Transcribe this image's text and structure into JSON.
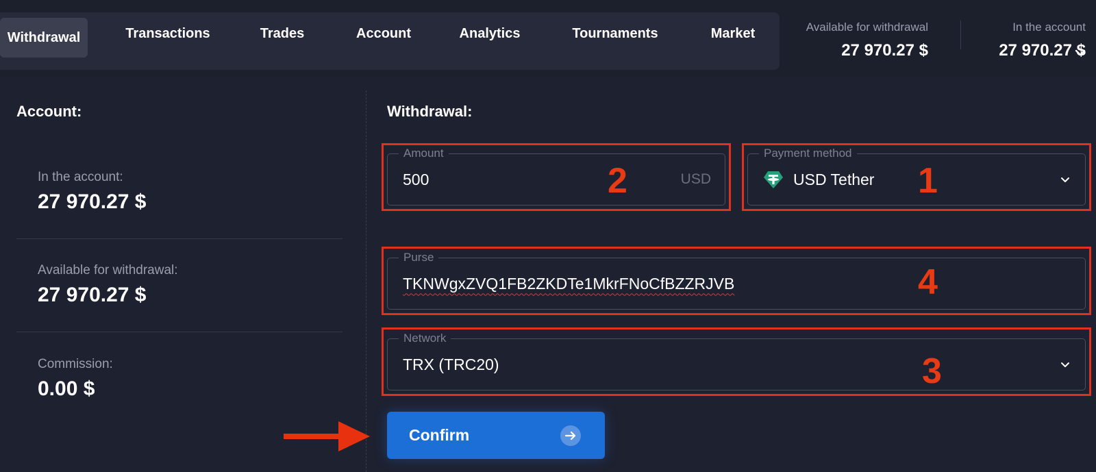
{
  "tabs": [
    {
      "label": "Withdrawal",
      "active": true
    },
    {
      "label": "Transactions"
    },
    {
      "label": "Trades"
    },
    {
      "label": "Account"
    },
    {
      "label": "Analytics"
    },
    {
      "label": "Tournaments"
    },
    {
      "label": "Market"
    }
  ],
  "header": {
    "available_label": "Available for withdrawal",
    "available_value": "27 970.27 $",
    "in_account_label": "In the account",
    "in_account_value": "27 970.27 $",
    "expand_icon": "chevron-down-icon"
  },
  "account_panel": {
    "heading": "Account:",
    "in_account_label": "In the account:",
    "in_account_value": "27 970.27 $",
    "available_label": "Available for withdrawal:",
    "available_value": "27 970.27 $",
    "commission_label": "Commission:",
    "commission_value": "0.00 $"
  },
  "withdrawal_form": {
    "heading": "Withdrawal:",
    "amount": {
      "label": "Amount",
      "value": "500",
      "currency": "USD"
    },
    "payment_method": {
      "label": "Payment method",
      "value": "USD Tether",
      "icon": "tether-icon"
    },
    "purse": {
      "label": "Purse",
      "value": "TKNWgxZVQ1FB2ZKDTe1MkrFNoCfBZZRJVB"
    },
    "network": {
      "label": "Network",
      "value": "TRX (TRC20)"
    },
    "confirm_label": "Confirm"
  },
  "annotations": {
    "step_payment_method": "1",
    "step_amount": "2",
    "step_network": "3",
    "step_purse": "4",
    "highlight_color": "#e0301e"
  },
  "colors": {
    "background": "#1e2130",
    "button": "#1c6fd6",
    "tether": "#26a17b"
  }
}
